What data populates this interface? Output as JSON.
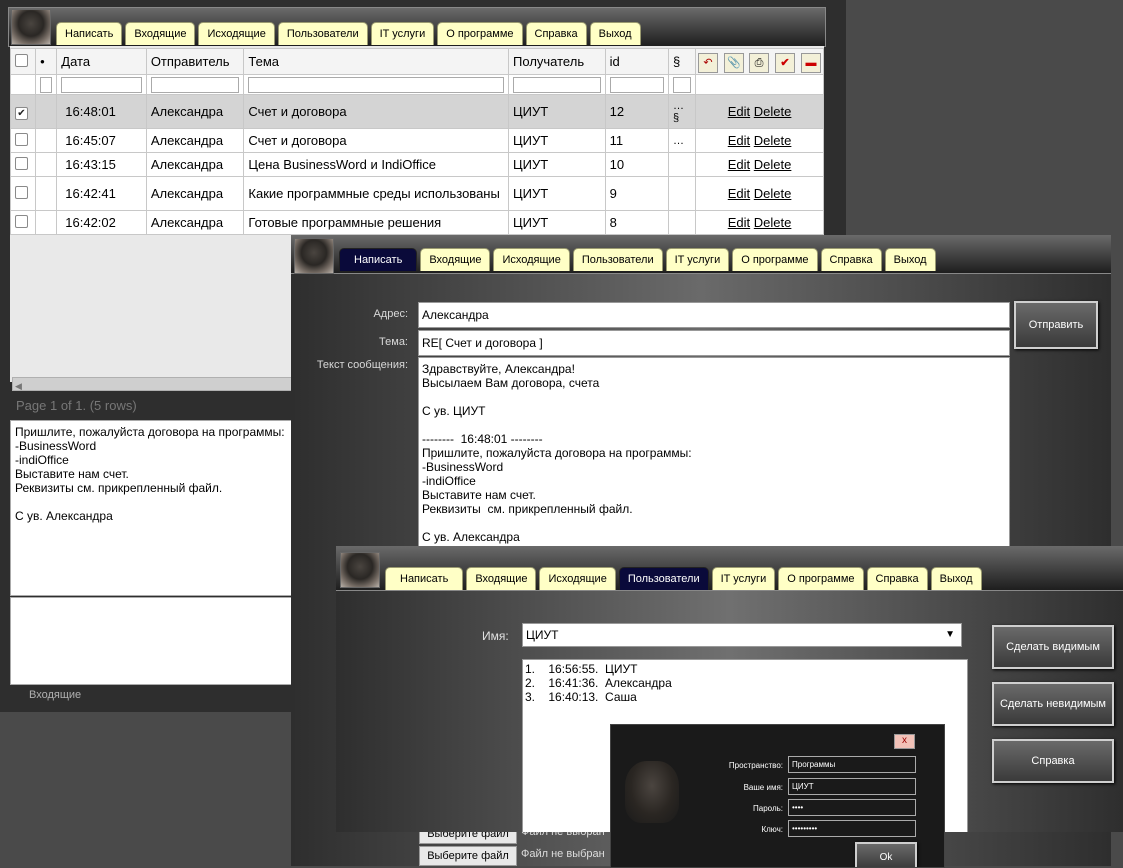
{
  "tabs": [
    "Написать",
    "Входящие",
    "Исходящие",
    "Пользователи",
    "IT услуги",
    "О программе",
    "Справка",
    "Выход"
  ],
  "inbox": {
    "headers": {
      "dot": "•",
      "date": "Дата",
      "sender": "Отправитель",
      "subject": "Тема",
      "recipient": "Получатель",
      "id": "id",
      "paragraph": "§"
    },
    "rows": [
      {
        "time": "16:48:01",
        "sender": "Александра",
        "subject": "Счет и договора",
        "recipient": "ЦИУТ",
        "id": "12",
        "mark": "…\n§",
        "edit": "Edit",
        "delete": "Delete",
        "checked": true
      },
      {
        "time": "16:45:07",
        "sender": "Александра",
        "subject": "Счет и договора",
        "recipient": "ЦИУТ",
        "id": "11",
        "mark": "…",
        "edit": "Edit",
        "delete": "Delete",
        "checked": false
      },
      {
        "time": "16:43:15",
        "sender": "Александра",
        "subject": "Цена BusinessWord и IndiOffice",
        "recipient": "ЦИУТ",
        "id": "10",
        "mark": "",
        "edit": "Edit",
        "delete": "Delete",
        "checked": false
      },
      {
        "time": "16:42:41",
        "sender": "Александра",
        "subject": "Какие программные среды использованы",
        "recipient": "ЦИУТ",
        "id": "9",
        "mark": "",
        "edit": "Edit",
        "delete": "Delete",
        "checked": false
      },
      {
        "time": "16:42:02",
        "sender": "Александра",
        "subject": "Готовые программные решения",
        "recipient": "ЦИУТ",
        "id": "8",
        "mark": "",
        "edit": "Edit",
        "delete": "Delete",
        "checked": false
      }
    ],
    "pager": "Page 1 of 1. (5 rows)",
    "preview": "Пришлите, пожалуйста договора на программы:\n-BusinessWord\n-indiOffice\nВыставите нам счет.\nРеквизиты см. прикрепленный файл.\n\nС ув. Александра",
    "status": "Входящие"
  },
  "compose": {
    "address_label": "Адрес:",
    "address_value": "Александра",
    "subject_label": "Тема:",
    "subject_value": "RE[ Счет и договора ]",
    "body_label": "Текст сообщения:",
    "body_value": "Здравствуйте, Александра!\nВысылаем Вам договора, счета\n\nС ув. ЦИУТ\n\n--------  16:48:01 --------\nПришлите, пожалуйста договора на программы:\n-BusinessWord\n-indiOffice\nВыставите нам счет.\nРеквизиты  см. прикрепленный файл.\n\nС ув. Александра",
    "send_label": "Отправить",
    "file_button": "Выберите файл",
    "file_status": "Файл не выбран"
  },
  "users": {
    "name_label": "Имя:",
    "name_value": "ЦИУТ",
    "list": [
      "1.    16:56:55.  ЦИУТ",
      "2.    16:41:36.  Александра",
      "3.    16:40:13.  Саша"
    ],
    "btn_visible": "Сделать видимым",
    "btn_invisible": "Сделать невидимым",
    "btn_help": "Справка"
  },
  "login": {
    "close": "x",
    "space_label": "Пространство:",
    "space_value": "Программы",
    "name_label": "Ваше имя:",
    "name_value": "ЦИУТ",
    "pass_label": "Пароль:",
    "pass_value": "••••",
    "key_label": "Ключ:",
    "key_value": "•••••••••",
    "ok": "Ok"
  }
}
